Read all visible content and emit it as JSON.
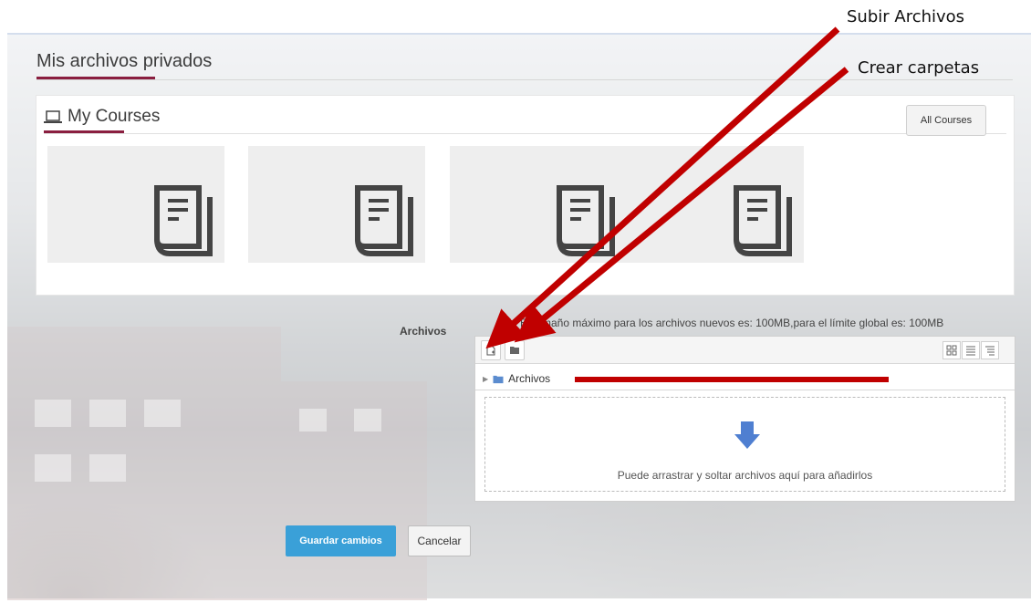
{
  "page": {
    "title": "Mis archivos privados"
  },
  "courses": {
    "heading": "My Courses",
    "heading_icon": "laptop-icon",
    "all_courses_label": "All Courses",
    "cards": [
      {
        "icon": "book-icon"
      },
      {
        "icon": "book-icon"
      },
      {
        "icon": "book-icon"
      },
      {
        "icon": "book-icon"
      }
    ]
  },
  "form": {
    "archivos_label": "Archivos",
    "max_size_text": "El tamaño máximo para los archivos nuevos es: 100MB,para el límite global es: 100MB"
  },
  "filemanager": {
    "toolbar": {
      "add_file_icon": "add-file-icon",
      "create_folder_icon": "create-folder-icon",
      "view_icons": [
        "grid-view-icon",
        "list-view-icon",
        "tree-view-icon"
      ]
    },
    "path_label": "Archivos",
    "drop_text": "Puede arrastrar y soltar archivos aquí para añadirlos",
    "drop_icon": "down-arrow-icon"
  },
  "buttons": {
    "save_label": "Guardar cambios",
    "cancel_label": "Cancelar"
  },
  "annotations": {
    "upload_label": "Subir Archivos",
    "folder_label": "Crear carpetas",
    "color": "#c00000"
  },
  "colors": {
    "accent": "#8a1e3f",
    "primary_button": "#3aa0d8"
  }
}
